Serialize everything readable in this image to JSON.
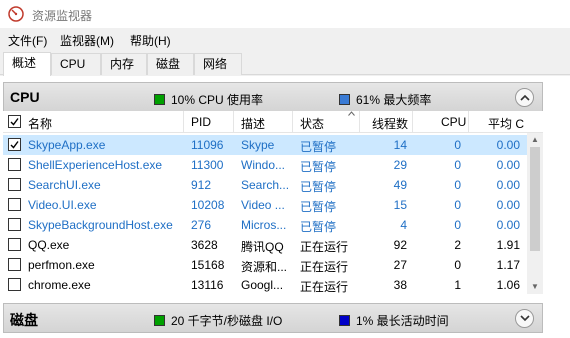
{
  "window": {
    "title": "资源监视器"
  },
  "menu": {
    "file": "文件(F)",
    "monitor": "监视器(M)",
    "help": "帮助(H)"
  },
  "tabs": [
    "概述",
    "CPU",
    "内存",
    "磁盘",
    "网络"
  ],
  "cpu_section": {
    "title": "CPU",
    "legend1": "10% CPU 使用率",
    "legend1_color": "#00a000",
    "legend2": "61% 最大频率",
    "legend2_color": "#3a7bd5"
  },
  "columns": {
    "name": "名称",
    "pid": "PID",
    "desc": "描述",
    "status": "状态",
    "threads": "线程数",
    "cpu": "CPU",
    "avg": "平均 C"
  },
  "processes": [
    {
      "name": "SkypeApp.exe",
      "pid": "11096",
      "desc": "Skype",
      "status": "已暂停",
      "threads": "14",
      "cpu": "0",
      "avg": "0.00",
      "checked": true,
      "suspended": true
    },
    {
      "name": "ShellExperienceHost.exe",
      "pid": "11300",
      "desc": "Windo...",
      "status": "已暂停",
      "threads": "29",
      "cpu": "0",
      "avg": "0.00",
      "checked": false,
      "suspended": true
    },
    {
      "name": "SearchUI.exe",
      "pid": "912",
      "desc": "Search...",
      "status": "已暂停",
      "threads": "49",
      "cpu": "0",
      "avg": "0.00",
      "checked": false,
      "suspended": true
    },
    {
      "name": "Video.UI.exe",
      "pid": "10208",
      "desc": "Video ...",
      "status": "已暂停",
      "threads": "15",
      "cpu": "0",
      "avg": "0.00",
      "checked": false,
      "suspended": true
    },
    {
      "name": "SkypeBackgroundHost.exe",
      "pid": "276",
      "desc": "Micros...",
      "status": "已暂停",
      "threads": "4",
      "cpu": "0",
      "avg": "0.00",
      "checked": false,
      "suspended": true
    },
    {
      "name": "QQ.exe",
      "pid": "3628",
      "desc": "腾讯QQ",
      "status": "正在运行",
      "threads": "92",
      "cpu": "2",
      "avg": "1.91",
      "checked": false,
      "suspended": false
    },
    {
      "name": "perfmon.exe",
      "pid": "15168",
      "desc": "资源和...",
      "status": "正在运行",
      "threads": "27",
      "cpu": "0",
      "avg": "1.17",
      "checked": false,
      "suspended": false
    },
    {
      "name": "chrome.exe",
      "pid": "13116",
      "desc": "Googl...",
      "status": "正在运行",
      "threads": "38",
      "cpu": "1",
      "avg": "1.06",
      "checked": false,
      "suspended": false
    }
  ],
  "disk_section": {
    "title": "磁盘",
    "legend1": "20 千字节/秒磁盘 I/O",
    "legend1_color": "#00a000",
    "legend2": "1% 最长活动时间",
    "legend2_color": "#0000c8"
  }
}
